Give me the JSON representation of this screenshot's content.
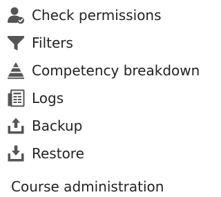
{
  "menu": {
    "items": [
      {
        "label": "Check permissions",
        "icon": "user-check-icon"
      },
      {
        "label": "Filters",
        "icon": "funnel-icon"
      },
      {
        "label": "Competency breakdown",
        "icon": "pyramid-icon"
      },
      {
        "label": "Logs",
        "icon": "log-icon"
      },
      {
        "label": "Backup",
        "icon": "upload-tray-icon"
      },
      {
        "label": "Restore",
        "icon": "download-tray-icon"
      }
    ]
  },
  "section": {
    "title": "Course administration"
  },
  "colors": {
    "icon": "#555555",
    "text": "#222222"
  }
}
